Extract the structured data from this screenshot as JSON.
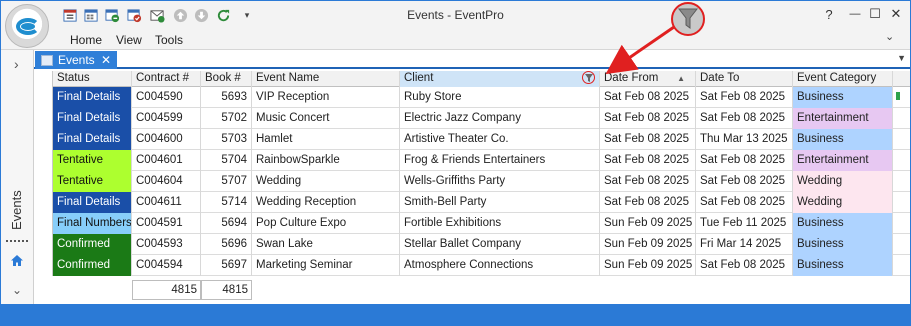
{
  "app": {
    "title": "Events - EventPro",
    "colors": {
      "accent": "#2b7ad6",
      "tab": "#2f7fd8",
      "callout": "#e02020"
    }
  },
  "quick_access": [
    {
      "icon": "calendar-new-icon"
    },
    {
      "icon": "calendar-grid-icon"
    },
    {
      "icon": "calendar-refresh-icon"
    },
    {
      "icon": "calendar-check-icon"
    },
    {
      "icon": "mail-icon"
    },
    {
      "icon": "arrow-up-icon"
    },
    {
      "icon": "arrow-down-icon"
    },
    {
      "icon": "refresh-icon"
    },
    {
      "icon": "customize-dropdown-icon"
    }
  ],
  "menu": {
    "home": "Home",
    "view": "View",
    "tools": "Tools"
  },
  "window_controls": {
    "help": "?",
    "minimize": "—",
    "maximize": "☐",
    "close": "✕"
  },
  "nav": {
    "expand": "›",
    "events": "Events",
    "down": "⌄"
  },
  "tab": {
    "label": "Events",
    "close": "✕",
    "dropdown": "▼"
  },
  "grid": {
    "columns": {
      "status": "Status",
      "contract": "Contract #",
      "book": "Book #",
      "event_name": "Event Name",
      "client": "Client",
      "date_from": "Date From",
      "date_to": "Date To",
      "event_category": "Event Category"
    },
    "sorted_column": "date_from",
    "filtered_column": "client",
    "rows": [
      {
        "status": "Final Details",
        "status_class": "final-details",
        "contract": "C004590",
        "book": "5693",
        "event_name": "VIP Reception",
        "client": "Ruby Store",
        "date_from": "Sat Feb 08 2025",
        "date_to": "Sat Feb 08 2025",
        "category": "Business",
        "category_class": "business"
      },
      {
        "status": "Final Details",
        "status_class": "final-details",
        "contract": "C004599",
        "book": "5702",
        "event_name": "Music Concert",
        "client": "Electric Jazz Company",
        "date_from": "Sat Feb 08 2025",
        "date_to": "Sat Feb 08 2025",
        "category": "Entertainment",
        "category_class": "entertainment"
      },
      {
        "status": "Final Details",
        "status_class": "final-details",
        "contract": "C004600",
        "book": "5703",
        "event_name": "Hamlet",
        "client": "Artistive Theater Co.",
        "date_from": "Sat Feb 08 2025",
        "date_to": "Thu Mar 13 2025",
        "category": "Business",
        "category_class": "business"
      },
      {
        "status": "Tentative",
        "status_class": "tentative",
        "contract": "C004601",
        "book": "5704",
        "event_name": "RainbowSparkle",
        "client": "Frog & Friends Entertainers",
        "date_from": "Sat Feb 08 2025",
        "date_to": "Sat Feb 08 2025",
        "category": "Entertainment",
        "category_class": "entertainment"
      },
      {
        "status": "Tentative",
        "status_class": "tentative",
        "contract": "C004604",
        "book": "5707",
        "event_name": "Wedding",
        "client": "Wells-Griffiths Party",
        "date_from": "Sat Feb 08 2025",
        "date_to": "Sat Feb 08 2025",
        "category": "Wedding",
        "category_class": "wedding"
      },
      {
        "status": "Final Details",
        "status_class": "final-details",
        "contract": "C004611",
        "book": "5714",
        "event_name": "Wedding Reception",
        "client": "Smith-Bell Party",
        "date_from": "Sat Feb 08 2025",
        "date_to": "Sat Feb 08 2025",
        "category": "Wedding",
        "category_class": "wedding"
      },
      {
        "status": "Final Numbers",
        "status_class": "final-numbers",
        "contract": "C004591",
        "book": "5694",
        "event_name": "Pop Culture Expo",
        "client": "Fortible Exhibitions",
        "date_from": "Sun Feb 09 2025",
        "date_to": "Tue Feb 11 2025",
        "category": "Business",
        "category_class": "business"
      },
      {
        "status": "Confirmed",
        "status_class": "confirmed",
        "contract": "C004593",
        "book": "5696",
        "event_name": "Swan Lake",
        "client": "Stellar Ballet Company",
        "date_from": "Sun Feb 09 2025",
        "date_to": "Fri Mar 14 2025",
        "category": "Business",
        "category_class": "business"
      },
      {
        "status": "Confirmed",
        "status_class": "confirmed",
        "contract": "C004594",
        "book": "5697",
        "event_name": "Marketing Seminar",
        "client": "Atmosphere Connections",
        "date_from": "Sun Feb 09 2025",
        "date_to": "Sat Feb 08 2025",
        "category": "Business",
        "category_class": "business"
      }
    ],
    "totals": {
      "contract": "4815",
      "book": "4815"
    }
  }
}
